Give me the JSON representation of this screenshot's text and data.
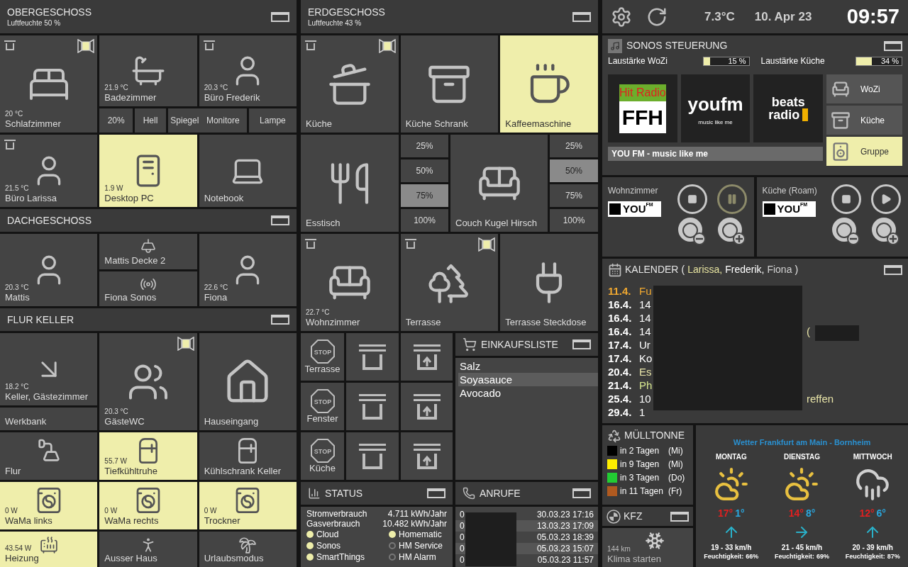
{
  "obergeschoss": {
    "title": "OBERGESCHOSS",
    "subtitle": "Luftfeuchte 50 %",
    "tiles": [
      {
        "name": "Schlafzimmer",
        "reading": "20 °C",
        "on": false,
        "blind": true,
        "window_open": true
      },
      {
        "name": "Badezimmer",
        "reading": "21.9 °C",
        "on": false,
        "blind": false,
        "window_open": false
      },
      {
        "name": "Büro Frederik",
        "reading": "20.3 °C",
        "on": false,
        "blind": true,
        "window_open": false
      },
      {
        "name": "Büro Larissa",
        "reading": "21.5 °C",
        "on": false,
        "blind": true,
        "window_open": false
      },
      {
        "name": "Desktop PC",
        "reading": "1.9 W",
        "on": true,
        "blind": false,
        "window_open": false
      },
      {
        "name": "Notebook",
        "on": false,
        "blind": false,
        "window_open": false
      }
    ],
    "buttons": [
      "20%",
      "Hell",
      "Spiegel",
      "Monitore",
      "Lampe"
    ]
  },
  "dachgeschoss": {
    "title": "DACHGESCHOSS",
    "tiles": [
      {
        "name": "Mattis",
        "reading": "20.3 °C",
        "on": false,
        "blind": false,
        "window_open": false
      },
      {
        "name": "Mattis Decke 2",
        "on": false,
        "blind": false,
        "window_open": false
      },
      {
        "name": "Fiona Sonos",
        "on": false,
        "blind": false,
        "window_open": false
      },
      {
        "name": "Fiona",
        "reading": "22.6 °C",
        "on": false,
        "blind": false,
        "window_open": false
      }
    ]
  },
  "flur_keller": {
    "title": "FLUR KELLER",
    "tiles": [
      {
        "name": "Keller, Gästezimmer",
        "reading": "18.2 °C",
        "on": false,
        "blind": false,
        "window_open": false
      },
      {
        "name": "Werkbank",
        "on": false,
        "blind": false,
        "window_open": false
      },
      {
        "name": "GästeWC",
        "reading": "20.3 °C",
        "on": false,
        "blind": false,
        "window_open": true
      },
      {
        "name": "Hauseingang",
        "on": false,
        "blind": false,
        "window_open": false
      },
      {
        "name": "Flur",
        "on": false,
        "blind": false,
        "window_open": false
      },
      {
        "name": "Tiefkühltruhe",
        "reading": "55.7 W",
        "on": true,
        "blind": false,
        "window_open": false
      },
      {
        "name": "Kühlschrank Keller",
        "on": false,
        "blind": false,
        "window_open": false
      },
      {
        "name": "WaMa links",
        "reading": "0 W",
        "on": true,
        "blind": false,
        "window_open": false
      },
      {
        "name": "WaMa rechts",
        "reading": "0 W",
        "on": true,
        "blind": false,
        "window_open": false
      },
      {
        "name": "Trockner",
        "reading": "0 W",
        "on": true,
        "blind": false,
        "window_open": false
      },
      {
        "name": "Heizung",
        "reading": "43.54 W",
        "on": true,
        "blind": false,
        "window_open": false
      },
      {
        "name": "Ausser Haus",
        "on": false,
        "blind": false,
        "window_open": false
      },
      {
        "name": "Urlaubsmodus",
        "on": false,
        "blind": false,
        "window_open": false
      }
    ]
  },
  "erdgeschoss": {
    "title": "ERDGESCHOSS",
    "subtitle": "Luftfeuchte 43 %",
    "tiles": [
      {
        "name": "Küche",
        "on": false,
        "blind": true,
        "window_open": true
      },
      {
        "name": "Küche Schrank",
        "on": false,
        "blind": false,
        "window_open": false
      },
      {
        "name": "Kaffeemaschine",
        "on": true,
        "blind": false,
        "window_open": false
      },
      {
        "name": "Esstisch",
        "on": false,
        "blind": false,
        "window_open": false
      },
      {
        "name": "Couch Kugel Hirsch",
        "on": false,
        "blind": false,
        "window_open": false
      },
      {
        "name": "Wohnzimmer",
        "reading": "22.7 °C",
        "on": false,
        "blind": true,
        "window_open": false
      },
      {
        "name": "Terrasse",
        "on": false,
        "blind": true,
        "window_open": true
      },
      {
        "name": "Terrasse Steckdose",
        "on": false,
        "blind": false,
        "window_open": false
      }
    ],
    "dimmers": [
      [
        {
          "label": "25%",
          "selected": false
        },
        {
          "label": "50%",
          "selected": false
        },
        {
          "label": "75%",
          "selected": true
        },
        {
          "label": "100%",
          "selected": false
        }
      ],
      [
        {
          "label": "25%",
          "selected": false
        },
        {
          "label": "50%",
          "selected": true
        },
        {
          "label": "75%",
          "selected": false
        },
        {
          "label": "100%",
          "selected": false
        }
      ]
    ]
  },
  "shutters": [
    {
      "stop": "STOP",
      "name": "Terrasse"
    },
    {
      "stop": "STOP",
      "name": "Fenster"
    },
    {
      "stop": "STOP",
      "name": "Küche"
    }
  ],
  "einkaufsliste": {
    "title": "EINKAUFSLISTE",
    "items": [
      {
        "text": "Salz",
        "selected": false
      },
      {
        "text": "Soyasauce",
        "selected": true
      },
      {
        "text": "Avocado",
        "selected": false
      }
    ]
  },
  "status": {
    "title": "STATUS",
    "metrics": [
      {
        "label": "Stromverbrauch",
        "value": "4.711 kWh/Jahr"
      },
      {
        "label": "Gasverbrauch",
        "value": "10.482 kWh/Jahr"
      }
    ],
    "indicators": [
      {
        "label": "Cloud",
        "on": true
      },
      {
        "label": "Homematic",
        "on": true
      },
      {
        "label": "Sonos",
        "on": true
      },
      {
        "label": "HM Service",
        "on": false
      },
      {
        "label": "SmartThings",
        "on": true
      },
      {
        "label": "HM Alarm",
        "on": false
      }
    ]
  },
  "anrufe": {
    "title": "ANRUFE",
    "calls": [
      {
        "number": "0",
        "time": "30.03.23 17:16"
      },
      {
        "number": "0",
        "time": "13.03.23 17:09"
      },
      {
        "number": "0",
        "time": "05.03.23 18:39"
      },
      {
        "number": "0",
        "time": "05.03.23 15:07"
      },
      {
        "number": "0",
        "time": "05.03.23 11:57"
      }
    ]
  },
  "top_bar": {
    "temperature": "7.3°C",
    "date": "10. Apr 23",
    "time": "09:57"
  },
  "sonos": {
    "title": "SONOS STEUERUNG",
    "volumes": [
      {
        "label": "Laustärke WoZi",
        "level": 0.15,
        "reading": "15 %"
      },
      {
        "label": "Laustärke Küche",
        "level": 0.34,
        "reading": "34 %"
      }
    ],
    "stations": [
      {
        "lines": [
          "Hit Radio",
          "FFH"
        ]
      },
      {
        "lines": [
          "youfm",
          "music like me"
        ]
      },
      {
        "lines": [
          "beats",
          "radio"
        ]
      }
    ],
    "now_playing": "YOU FM - music like me",
    "rooms": [
      {
        "label": "WoZi",
        "selected": false
      },
      {
        "label": "Küche",
        "selected": false
      },
      {
        "label": "Gruppe",
        "selected": true
      }
    ]
  },
  "players": [
    {
      "room": "Wohnzimmer",
      "logo": [
        "YOU",
        "FM"
      ],
      "playing": true
    },
    {
      "room": "Küche (Roam)",
      "logo": [
        "YOU",
        "FM"
      ],
      "playing": false
    }
  ],
  "kalender": {
    "title": "KALENDER",
    "open": "(",
    "persons": [
      {
        "name": "Larissa,",
        "color": "#e6e3a0"
      },
      {
        "name": "Frederik,",
        "color": "#ffffff"
      },
      {
        "name": "Fiona",
        "color": "#d2d2d2"
      }
    ],
    "close": ")",
    "entries": [
      {
        "date": "11.4.",
        "text": "Fu",
        "color": "#f0a830",
        "today": true
      },
      {
        "date": "16.4.",
        "text": "14",
        "color": "#ffffff",
        "today": false
      },
      {
        "date": "16.4.",
        "text": "14",
        "color": "#ffffff",
        "today": false
      },
      {
        "date": "16.4.",
        "text": "14",
        "right": "(",
        "color": "#ffffff",
        "today": false
      },
      {
        "date": "17.4.",
        "text": "Ur",
        "color": "#ffffff",
        "today": false
      },
      {
        "date": "17.4.",
        "text": "Ko",
        "color": "#ffffff",
        "today": false
      },
      {
        "date": "20.4.",
        "text": "Es",
        "color": "#e8e4a8",
        "today": false
      },
      {
        "date": "21.4.",
        "text": "Ph",
        "color": "#d8e890",
        "today": false
      },
      {
        "date": "25.4.",
        "text": "10",
        "right": "reffen",
        "color": "#ffffff",
        "today": false
      },
      {
        "date": "29.4.",
        "text": "1",
        "color": "#ffffff",
        "today": false
      }
    ]
  },
  "muell": {
    "title": "MÜLLTONNE",
    "items": [
      {
        "text": "in 2 Tagen",
        "day": "(Mi)",
        "color": "#000000"
      },
      {
        "text": "in 9 Tagen",
        "day": "(Mi)",
        "color": "#ffee00"
      },
      {
        "text": "in 3 Tagen",
        "day": "(Do)",
        "color": "#22cc33"
      },
      {
        "text": "in 11 Tagen",
        "day": "(Fr)",
        "color": "#b05a20"
      }
    ]
  },
  "kfz": {
    "title": "KFZ",
    "reading": "144 km",
    "label": "Klima starten"
  },
  "wetter": {
    "title": "Wetter Frankfurt am Main - Bornheim",
    "days": [
      {
        "name": "MONTAG",
        "high": "17°",
        "low": "1°",
        "wind": "19 - 33 km/h",
        "humidity_label": "Feuchtigkeit:",
        "humidity": "66%"
      },
      {
        "name": "DIENSTAG",
        "high": "14°",
        "low": "8°",
        "wind": "21 - 45 km/h",
        "humidity_label": "Feuchtigkeit:",
        "humidity": "69%"
      },
      {
        "name": "MITTWOCH",
        "high": "12°",
        "low": "6°",
        "wind": "20 - 39 km/h",
        "humidity_label": "Feuchtigkeit:",
        "humidity": "87%"
      }
    ]
  }
}
